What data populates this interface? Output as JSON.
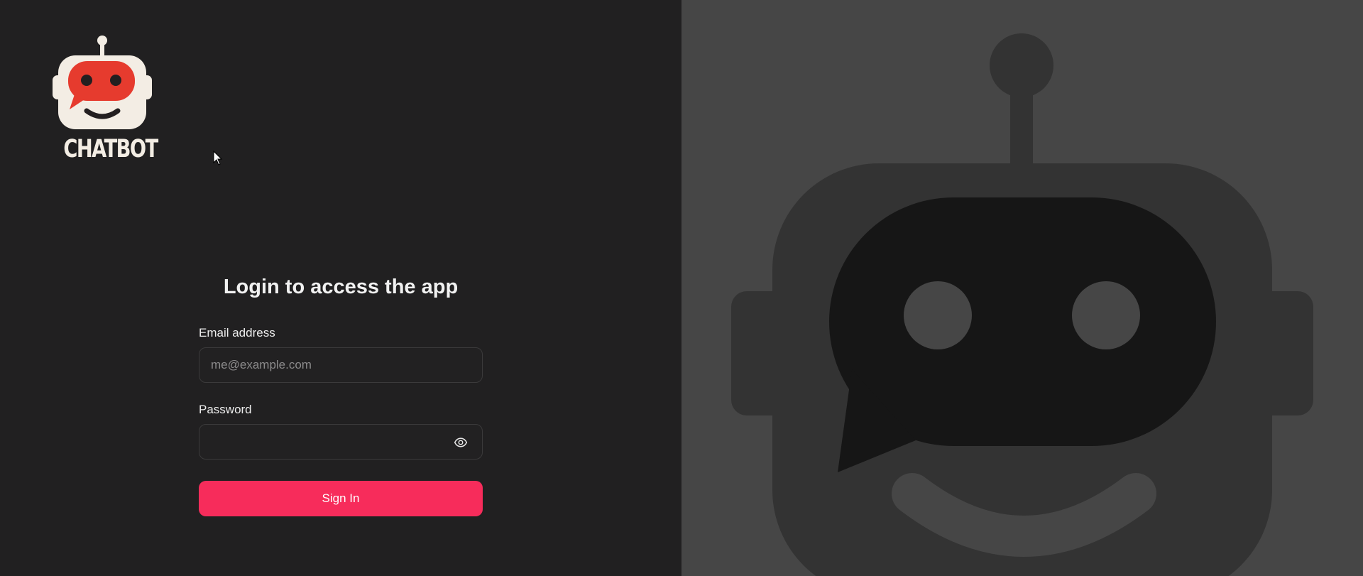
{
  "brand": {
    "name": "CHATBOT",
    "logo_icon": "robot-chat-icon",
    "colors": {
      "logo_face": "#f3ede4",
      "logo_bubble": "#e63b2e",
      "logo_dark": "#231f20"
    }
  },
  "login": {
    "title": "Login to access the app",
    "email": {
      "label": "Email address",
      "placeholder": "me@example.com",
      "value": ""
    },
    "password": {
      "label": "Password",
      "value": "",
      "toggle_icon": "eye-icon"
    },
    "submit_label": "Sign In"
  },
  "theme": {
    "left_background": "#212021",
    "right_background": "#464646",
    "accent": "#f72c5b"
  },
  "hero": {
    "icon": "robot-chat-icon"
  }
}
